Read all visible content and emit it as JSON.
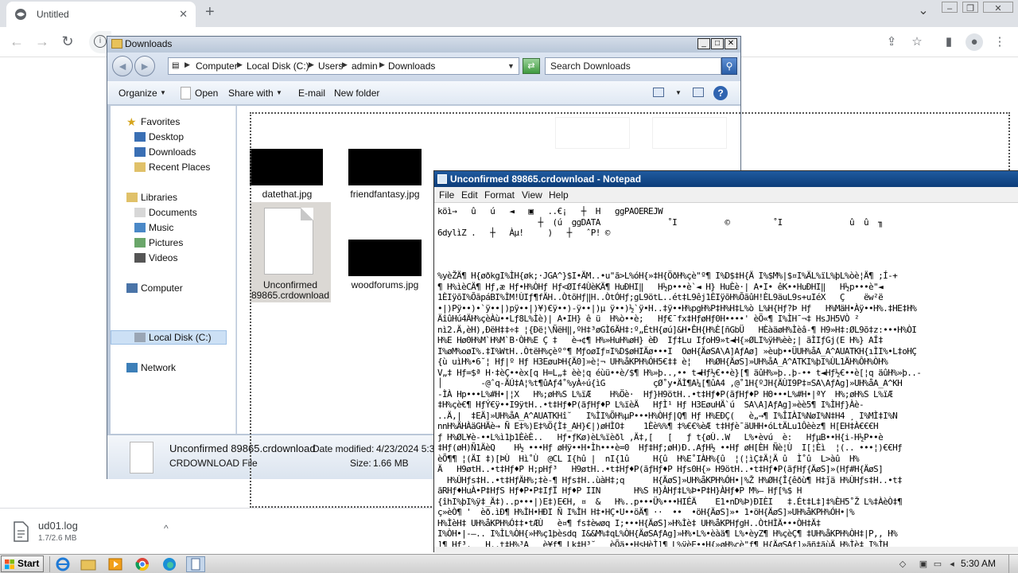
{
  "chrome": {
    "tab_title": "Untitled",
    "close_glyph": "✕",
    "new_tab_glyph": "+",
    "dropdown_glyph": "⌄"
  },
  "download_shelf": {
    "file_name": "ud01.log",
    "progress_text": "1.7/2.6 MB",
    "chevron": "^"
  },
  "explorer": {
    "title": "Downloads",
    "breadcrumbs": [
      "Computer",
      "Local Disk (C:)",
      "Users",
      "admin",
      "Downloads"
    ],
    "search_placeholder": "Search Downloads",
    "commands": {
      "organize": "Organize",
      "open": "Open",
      "share_with": "Share with",
      "email": "E-mail",
      "new_folder": "New folder"
    },
    "nav": {
      "favorites": "Favorites",
      "desktop": "Desktop",
      "downloads": "Downloads",
      "recent_places": "Recent Places",
      "libraries": "Libraries",
      "documents": "Documents",
      "music": "Music",
      "pictures": "Pictures",
      "videos": "Videos",
      "computer": "Computer",
      "local_disk": "Local Disk (C:)",
      "network": "Network"
    },
    "files": [
      {
        "name": "datethat.jpg"
      },
      {
        "name": "friendfantasy.jpg"
      },
      {
        "name_line1": "Unconfirmed",
        "name_line2": "89865.crdownload"
      },
      {
        "name": "woodforums.jpg"
      }
    ],
    "details": {
      "file_name": "Unconfirmed 89865.crdownload",
      "file_type": "CRDOWNLOAD File",
      "date_label": "Date modified:",
      "date_value": "4/23/2024 5:30",
      "size_label": "Size:",
      "size_value": "1.66 MB"
    }
  },
  "notepad": {
    "title": "Unconfirmed 89865.crdownload - Notepad",
    "menus": [
      "File",
      "Edit",
      "Format",
      "View",
      "Help"
    ],
    "lines": [
      "köì→   û   ú   ◄   ▣   ..€¡   ┼  H   ggPAOEREJW",
      "                     ┼  (ú  ggDATA              ˚I          ©         ˚I              û  û  ╖",
      "6dylìZ .   ┼   Àµ!     )   ┼   ˆP! ©",
      "",
      "",
      "",
      "%yèŽÄ¶ H{øðkgI%ÌH{øk;·JGA^}$I•ÄM..•u\"ã>L%óH{»‡H{ÖðH%çè\"º¶ I%D$‡H{Ä I%$M%|$¤I%ÄL%ïL%þL%òè¦Ä¶ ;Í-+",
      "¶ H%ìèCÄ¶ Hƒ,æ Hƒ•H%ÒHƒ Hƒ<ØIf4ÙèKÄ¶ HuÐHI‖   H½p•••è`◄ H} HuÈè·| A•I• êK••HuÐHI‖   H½p•••è\"◄",
      "1ÈIÿõI%ÕãpáBI%ÌM!ÙIƒ¶fÄH..ÒtõHƒ‖H..ÒtÓHƒ;gL9ötL..ét‡L9êj1ÈIÿõH%ÕãûH!ÈL9äuL9s+uIéX   Ç    ëw²ë",
      "•|)Pÿ••)•`ÿ••|)pÿ••|)¥)€ÿ••)-ÿ••|)µ ÿ••)½`ÿ•H..‡ÿ••H%pgH%P‡H%H‡L%ò L%H{Hƒ?Þ Hƒ   H%MäH•Àÿ••H%.‡HE‡H%",
      "ÄîûHú4ÄH%çèÀù••Lƒ8L%Ìè)| A•IH} ê ü  H%ò••è;   Hƒ€¯fx‡HƒøHƒ0H••••' èÖ«¶ I%ÌH¯¬‡ HsJH5VÒ ²",
      "nì2.Ä,èH),ÐëH‡‡÷‡ ¦{Ðë¦\\ÑëH‖,ºH‡³øGÌ6ÄH‡:º„ÉtH{øú]&H•ÊH{H%È[ñGbÜ   HÈàäøH%Ìèâ-¶ H9»H‡:ØL9õ‡z:•••H%ÒI",
      "H%E Hø0H%M`H%M`B·ÒH%E Ç ‡   è→¢¶ H%»HuH%øH} èÐ  Iƒ‡Lu IƒoH9»t◄H{»ØLI%ÿH%èè;| ãÌIƒGj(E H%} AÍ‡",
      "I%øM%oøI%.‡I%WtH..ÒtëH%çèº°¶ MƒoøIƒ¤I%D$øHIÄø•••I  OøH{ÄøSA\\A]AƒAø] »èuþ••ÜUH%åA_A^AUATKH{ıÌI%•L‡oHÇ",
      "{ù uìH%•6˘¦ Hƒ|º Hƒ H3EøuÞH{Ä0]»è¦¬ UH%åKPH%ÓH5€‡‡ è¦   H%ØH{ÄøS]»UH%åA_A^ATKI%þI%ÙL1ÄH%ÔH%ÒH%",
      "V„‡ Hƒ=$ª H·‡èÇ••èx[q H=L„‡ èè¦q éùü••è/$¶ H%»þ..,•• t◄Hƒ½€••è}[¶ äûH%»þ..þ-•• t◄Hƒ½€••è[¦q äûH%»þ..-",
      "│        -@ˆq-ÄÚ‡A¦%t¶ûAƒ4˚%yÀ÷ú{ìG          çØ˚y•ÄÌ¶A¼[¶ûA4 ,@˚1H{ºJH{ÄÙI9P‡¤SA\\AƒAg]»UH%åA_A^KH",
      "-ÌÀ Hp•••L%#H•|¦X   H%;øH%S L%ïÆ    H%Öè·  Hƒ}H9ötH..•t‡Hƒ♦P(ãƒHƒ♦P HΘ•••L%#H•|ªY  H%;øH%S L%ïÆ",
      "‡H%çè€¶ HƒÝ€ÿ••I9ÿtH..•t‡Hƒ♦P(ãƒHƒ♦P L%ïèÄ   HƒÌ¹ Hƒ H3EøuHÄ`ú  SA\\A]AƒAg]»èè5¶ I%ÌHƒ}Àè-",
      "..Ä,|  ‡EÄ]»UH%åA_A^AUATKHî˘   I%ÌI%ÕH%µP•••H%ÒHƒ|Q¶ Hƒ H%EÐÇ(   è„→¶ I%ÎIÀI%NøI%N‡H4 ¸ I%MÌ‡I%N",
      "nnH%ÄHÀäGHÄè→ Ñ E‡%)E‡%Ö{Ì‡_AH}€|)øHÌO‡    1Èè%%¶ ‡%€€%èÆ t‡Hƒè¯äUHH•óLtÄLu1Ôèèz¶ H[EH‡À€€€H",
      "ƒ H%ØL¥è-••L%ì1þ1ÈèÈ..   Hƒ•ƒKø)èL%ïèðl ,Ä‡,[   [   ƒ t{øÙ..W   L%•èvú  è:   HƒµB••H{i-H½P••è",
      "‡Hƒ(øH)Ñ1ÄèQ    H½ •••Hƒ øHÿ••H•Ìh•••è=0  Hƒ‡Hƒ;øH)Ð..AƒH½ ••Hƒ øH[ÈH Ñè¦Ù  I[¦Èì  ¦(.. •••¦)€€Hƒ",
      "èÕ¶¶ ¦(ÄI ‡)[ÞÙ  Hì˚Ù  @CL I{hû |  nI{1û     H{û  H%E˚IÀH%{û  ¦(¦ìÇ‡Ä¦Ä û  Ì˚û  L>àû  H%",
      "Ä   H9øtH..•t‡Hƒ♦P H;pHƒ³   H9øtH..•t‡Hƒ♦P(ãƒHƒ♦P Hƒs0H{» H9ötH..•t‡Hƒ♦P(ãƒHƒ{ÄøS]»(Hƒ#H{ÄøS]",
      "  H%ÙHƒs‡H..•t‡HƒÄH%;‡è-¶ Hƒs‡H..ùàH‡;q      H{ÄøS]»UH%åKPH%ÓH•|%Ž H%ØH{Î{êðù¶ H‡ǰä H%ÙHƒs‡H..•t‡",
      "ãRHƒ♦HuÀ•P‡HƒS Hƒ♦P•P‡IƒÏ Hƒ♦P IIN       H%S H}ÀHƒ‡L%Þ•P‡H}ÀHƒ♦P M%— Hƒ[%$ H",
      "{îhI%þI%ÿ‡_Ä‡)..p•••|)E‡)E€H, ¤  &   H%..p•••Ü%•••HIÉÄ    E1•nD%Þ)ÐIÈI   ‡.Ét‡L‡]‡%ÈH5˚Ž L%‡ÀèÒ‡¶",
      "ç»èÒ¶ '  èð.ìÐ¶ H%ÌH•HÐI Ñ I%ÌH H‡•HÇ•U••öÄ¶ ··  ••  •öH{ÄøS]»• 1•öH{ÄøS]»UH%åKPH%ÓH•|%",
      "H%ÌèH‡ UH%åKPH%Ó‡‡•tÆÙ   è¤¶ fs‡èwøq I;•••H{ÄøS]»H%Ìè‡ UH%åKPHƒgH..ÒtHÌÄ•••ÒH‡Ä‡",
      "I%ÒH•|-—.. I%ÌL%ÒH{»H%ç1þèsdq I&&M%‡qL%ÒH{ÄøSAƒAg]»H%•L%•èàä¶ L%•èyZ¶ H%çèÇ¶ ‡UH%åKPH%ÒH‡|P,, H%",
      "]¶ Hƒ³,   H..t‡H%³A   è¥ƒ¶ Lk‡H³˘   èÕä••HsHèÌ]¶ L%ÿèE••H{»øH%çè\"ƒ¶ H{ÄøSAƒ]»ãñ‡ãùÄ H%Ìè‡ I%ÌH"
    ]
  },
  "taskbar": {
    "start_label": "Start",
    "clock": "5:30 AM"
  }
}
